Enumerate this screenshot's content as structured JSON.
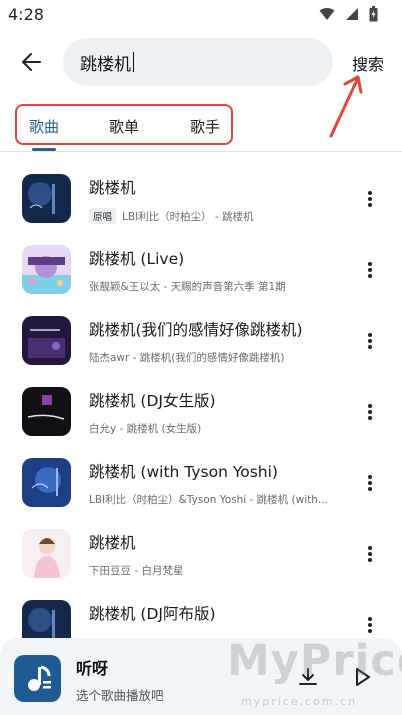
{
  "status": {
    "time": "4:28"
  },
  "search": {
    "query": "跳楼机",
    "button_label": "搜索"
  },
  "tabs": [
    {
      "label": "歌曲",
      "active": true
    },
    {
      "label": "歌单",
      "active": false
    },
    {
      "label": "歌手",
      "active": false
    }
  ],
  "songs": [
    {
      "title": "跳楼机",
      "badge": "原唱",
      "subtitle": "LBI利比（时柏尘） - 跳楼机",
      "cover": "dark-blue-night"
    },
    {
      "title": "跳楼机 (Live)",
      "badge": "",
      "subtitle": "张靓颖&王以太 - 天赐的声音第六季 第1期",
      "cover": "colorful-show"
    },
    {
      "title": "跳楼机(我们的感情好像跳楼机)",
      "badge": "",
      "subtitle": "陆杰awr - 跳楼机(我们的感情好像跳楼机)",
      "cover": "purple-night"
    },
    {
      "title": "跳楼机 (DJ女生版)",
      "badge": "",
      "subtitle": "白允y - 跳楼机 (女生版)",
      "cover": "dark-purple"
    },
    {
      "title": "跳楼机 (with Tyson Yoshi)",
      "badge": "",
      "subtitle": "LBI利比（时柏尘）&Tyson Yoshi - 跳楼机 (with...",
      "cover": "blue-night"
    },
    {
      "title": "跳楼机",
      "badge": "",
      "subtitle": "下田豆豆 - 白月梵星",
      "cover": "pink-portrait"
    },
    {
      "title": "跳楼机 (DJ阿布版)",
      "badge": "",
      "subtitle": "",
      "cover": "dark-blue-night"
    }
  ],
  "player": {
    "title": "听呀",
    "subtitle": "选个歌曲播放吧"
  },
  "watermark": {
    "text": "MyPrice",
    "sub": "myprice.com.cn"
  },
  "colors": {
    "accent": "#2e5f8a",
    "annotation": "#e0463a",
    "player_bg": "#f1f5f8"
  }
}
